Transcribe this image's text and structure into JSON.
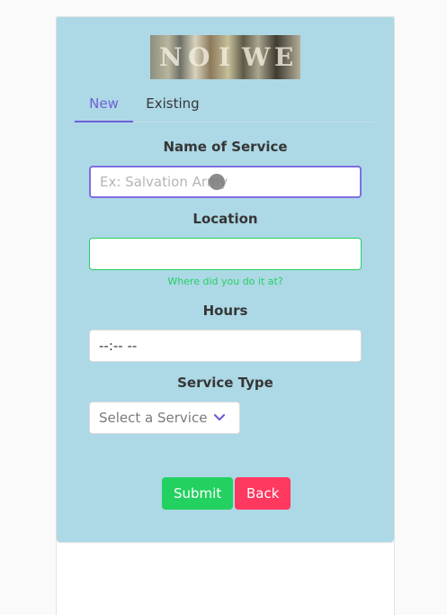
{
  "logo": {
    "letters": [
      "N",
      "O",
      "I",
      "W",
      "E"
    ]
  },
  "tabs": [
    {
      "label": "New",
      "active": true
    },
    {
      "label": "Existing",
      "active": false
    }
  ],
  "form": {
    "name_label": "Name of Service",
    "name_placeholder": "Ex: Salvation Army",
    "name_value": "",
    "location_label": "Location",
    "location_value": "",
    "location_help": "Where did you do it at?",
    "hours_label": "Hours",
    "hours_value": "--:-- --",
    "service_type_label": "Service Type",
    "service_type_selected": "Select a Service",
    "chevron_icon": "chevron-down-icon"
  },
  "buttons": {
    "submit_label": "Submit",
    "back_label": "Back"
  },
  "colors": {
    "card_bg": "#add8e6",
    "accent": "#6f5fd6",
    "success": "#23d160",
    "danger": "#ff3860",
    "text": "#363636"
  }
}
